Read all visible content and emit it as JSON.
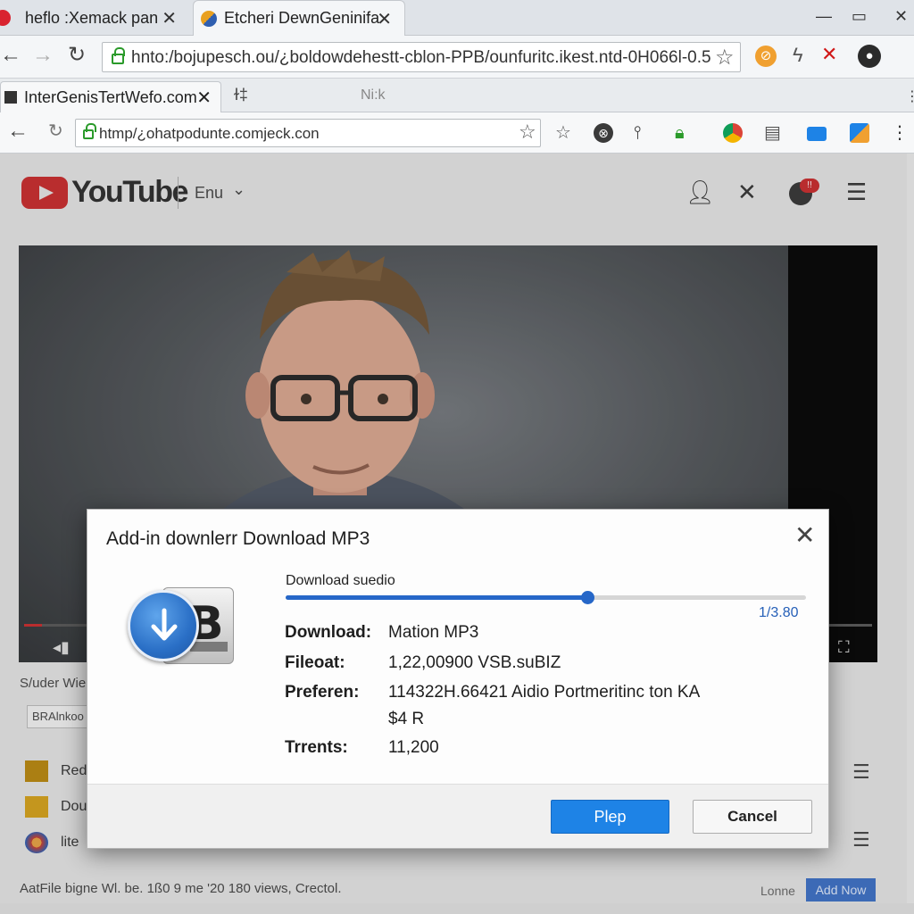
{
  "outer_browser": {
    "tabs": [
      {
        "title": "heflo :Xemack pan",
        "close": "✕",
        "favicon_color": "#d9232f"
      },
      {
        "title": "Etcheri DewnGeninifa",
        "close": "✕",
        "favicon_color": "#e8a020"
      }
    ],
    "window_controls": {
      "minimize": "—",
      "maximize": "▭",
      "close": "✕"
    },
    "url": "hnto:/bojupesch.ou/¿boldowdehestt-cblon-PPB/ounfuritc.ikest.ntd-0H066l-0.5"
  },
  "inner_browser": {
    "tab": {
      "title": "InterGenisTertWefo.com",
      "close": "✕"
    },
    "tab_extra": [
      "ɫ‡",
      "Ni:k"
    ],
    "url": "htmp/¿ohatpodunte.comjeck.con"
  },
  "youtube": {
    "logo_text": "YouTube",
    "language": "Enu",
    "notification_badge": "!!",
    "under_video_text": "S/uder Wie",
    "under_box_text": "BRAlnkoo",
    "list_items": [
      {
        "label": "Red",
        "thumb_color": "#b8860b"
      },
      {
        "label": "Dou",
        "thumb_color": "#d4a017"
      },
      {
        "label": "lite",
        "thumb_color": "#c83a2a"
      }
    ],
    "bottom_text": "AatFile bigne Wl. be. 1ß0 9 me '20 180 views, Crectol.",
    "bottom_right_text": "Lonne",
    "add_now": "Add Now"
  },
  "dialog": {
    "title": "Add-in downlerr Download MP3",
    "close": "✕",
    "progress_label": "Download suedio",
    "progress_fraction": 0.58,
    "progress_value": "1/3.80",
    "fields": [
      {
        "key": "Download:",
        "value": "Mation MP3"
      },
      {
        "key": "Fileoat:",
        "value": "1,22,00900 VSB.suBIZ"
      },
      {
        "key": "Preferen:",
        "value": "114322H.66421 Aidio Portmeritinc ton KA"
      },
      {
        "key": "",
        "value": "$4 R"
      },
      {
        "key": "Trrents:",
        "value": "11,200"
      }
    ],
    "primary_button": "Plep",
    "cancel_button": "Cancel"
  },
  "colors": {
    "accent_blue": "#1e83e6",
    "youtube_red": "#c8282a",
    "progress_blue": "#2667c8"
  }
}
